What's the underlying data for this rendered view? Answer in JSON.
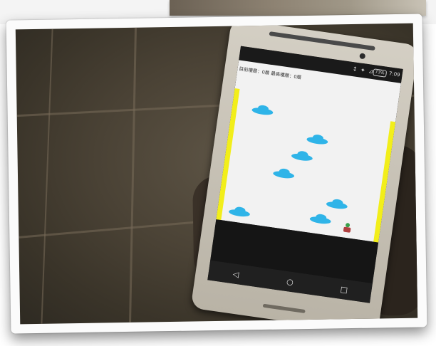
{
  "photo_caption": "",
  "phone": {
    "status_bar": {
      "icons": "↕ ✦ ⊿",
      "battery": "73%",
      "time": "7:09"
    },
    "game": {
      "score_line": "目前樓層：0層 最高樓層：0層",
      "colors": {
        "background": "#f2f2f2",
        "wall": "#f2ee1a",
        "cloud": "#2fb4e8"
      }
    },
    "nav": {
      "back": "◁",
      "home": "○",
      "recent": "□"
    }
  }
}
